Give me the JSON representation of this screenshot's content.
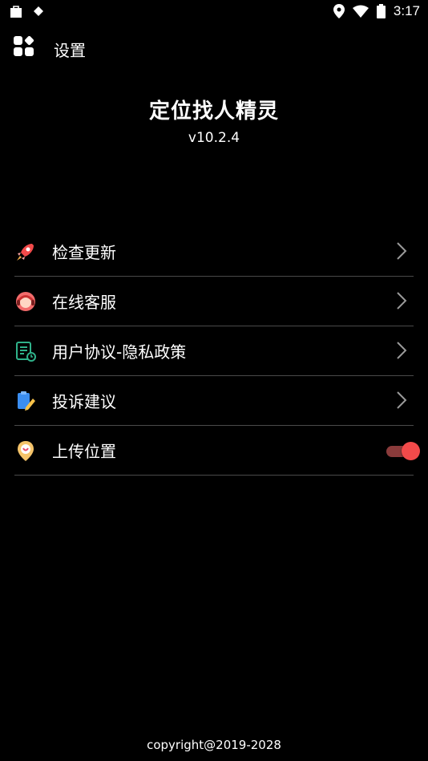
{
  "status_bar": {
    "time": "3:17",
    "left_icons": [
      "bag-icon",
      "diamond-icon"
    ],
    "right_icons": [
      "location-icon",
      "wifi-icon",
      "battery-icon"
    ]
  },
  "header": {
    "title": "设置",
    "icon": "grid-icon"
  },
  "app": {
    "name": "定位找人精灵",
    "version": "v10.2.4"
  },
  "menu": [
    {
      "label": "检查更新",
      "icon": "rocket-icon",
      "action": "chevron"
    },
    {
      "label": "在线客服",
      "icon": "customer-service-icon",
      "action": "chevron"
    },
    {
      "label": "用户协议-隐私政策",
      "icon": "document-icon",
      "action": "chevron"
    },
    {
      "label": "投诉建议",
      "icon": "edit-note-icon",
      "action": "chevron"
    },
    {
      "label": "上传位置",
      "icon": "location-pin-icon",
      "action": "toggle",
      "toggle_on": true
    }
  ],
  "footer": {
    "copyright": "copyright@2019-2028"
  },
  "colors": {
    "background": "#000000",
    "accent": "#f24a4a",
    "divider": "#4a4a4a"
  }
}
